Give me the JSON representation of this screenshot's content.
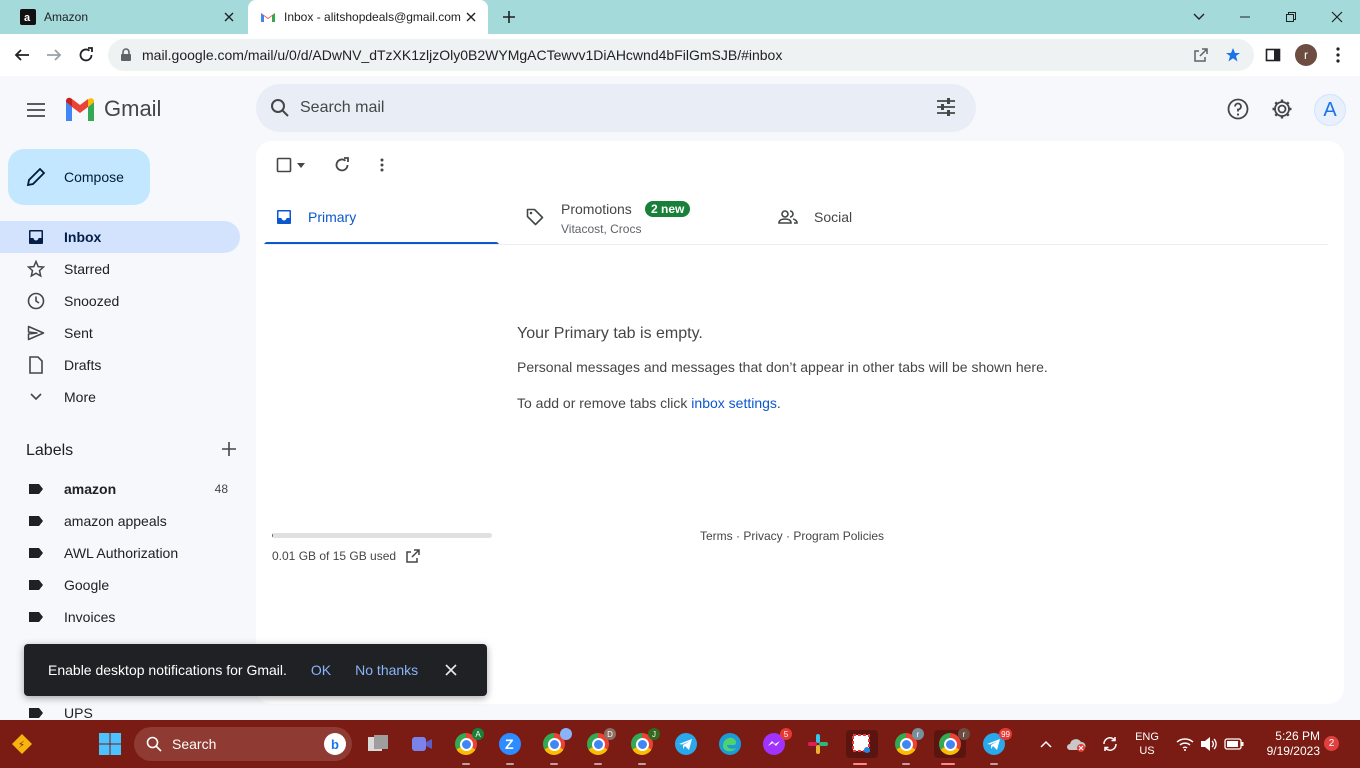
{
  "browser": {
    "tabs": [
      {
        "title": "Amazon",
        "favicon": "amazon-logo-icon",
        "active": false
      },
      {
        "title": "Inbox - alitshopdeals@gmail.com",
        "favicon": "gmail-logo-icon",
        "active": true
      }
    ],
    "url": "mail.google.com/mail/u/0/d/ADwNV_dTzXK1zljzOly0B2WYMgACTewvv1DiAHcwnd4bFilGmSJB/#inbox",
    "profile_initial": "r"
  },
  "gmail": {
    "brand": "Gmail",
    "search_placeholder": "Search mail",
    "account_initial": "A",
    "compose_label": "Compose",
    "nav": [
      {
        "label": "Inbox",
        "icon": "inbox-icon",
        "active": true
      },
      {
        "label": "Starred",
        "icon": "star-icon",
        "active": false
      },
      {
        "label": "Snoozed",
        "icon": "clock-icon",
        "active": false
      },
      {
        "label": "Sent",
        "icon": "send-icon",
        "active": false
      },
      {
        "label": "Drafts",
        "icon": "draft-icon",
        "active": false
      },
      {
        "label": "More",
        "icon": "chevron-down-icon",
        "active": false
      }
    ],
    "labels_title": "Labels",
    "labels": [
      {
        "name": "amazon",
        "count": "48",
        "bold": true
      },
      {
        "name": "amazon appeals",
        "count": "",
        "bold": false
      },
      {
        "name": "AWL Authorization",
        "count": "",
        "bold": false
      },
      {
        "name": "Google",
        "count": "",
        "bold": false
      },
      {
        "name": "Invoices",
        "count": "",
        "bold": false
      },
      {
        "name": "UPS",
        "count": "",
        "bold": false
      }
    ],
    "category_tabs": {
      "primary": {
        "label": "Primary"
      },
      "promotions": {
        "label": "Promotions",
        "badge": "2 new",
        "subtitle": "Vitacost, Crocs"
      },
      "social": {
        "label": "Social"
      }
    },
    "empty_state": {
      "heading": "Your Primary tab is empty.",
      "line1": "Personal messages and messages that don’t appear in other tabs will be shown here.",
      "line2_prefix": "To add or remove tabs click ",
      "line2_link": "inbox settings",
      "line2_suffix": "."
    },
    "storage": {
      "text": "0.01 GB of 15 GB used",
      "fraction_used": 0.001
    },
    "footer": {
      "terms": "Terms",
      "privacy": "Privacy",
      "policies": "Program Policies",
      "sep": " · "
    },
    "notification": {
      "message": "Enable desktop notifications for Gmail.",
      "ok": "OK",
      "no_thanks": "No thanks"
    }
  },
  "taskbar": {
    "search_label": "Search",
    "apps": [
      {
        "name": "chrome-profile-a",
        "badge": "A"
      },
      {
        "name": "zoom",
        "badge": ""
      },
      {
        "name": "chrome-profile-photo",
        "badge": ""
      },
      {
        "name": "chrome-profile-d",
        "badge": "D"
      },
      {
        "name": "chrome-profile-j",
        "badge": "J"
      },
      {
        "name": "telegram",
        "badge": ""
      },
      {
        "name": "edge",
        "badge": ""
      },
      {
        "name": "messenger",
        "badge": "5"
      },
      {
        "name": "slack",
        "badge": ""
      },
      {
        "name": "snipping-tool",
        "badge": ""
      },
      {
        "name": "chrome-profile-r1",
        "badge": "r"
      },
      {
        "name": "chrome-profile-r2",
        "badge": "r"
      },
      {
        "name": "telegram-2",
        "badge": "99"
      }
    ],
    "lang_top": "ENG",
    "lang_bottom": "US",
    "time": "5:26 PM",
    "date": "9/19/2023",
    "notifications": "2"
  }
}
